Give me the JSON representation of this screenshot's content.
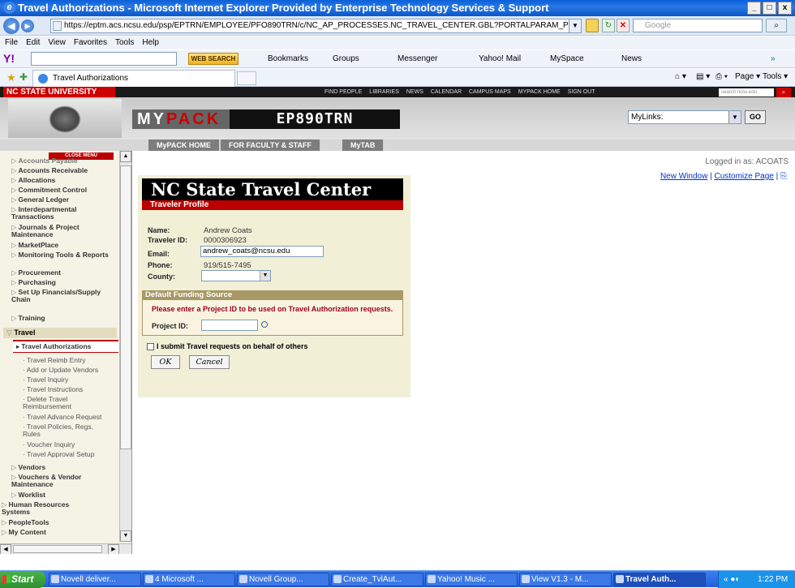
{
  "browser": {
    "title": "Travel Authorizations - Microsoft Internet Explorer Provided by Enterprise Technology Services & Support",
    "url": "https://eptm.acs.ncsu.edu/psp/EPTRN/EMPLOYEE/PFO890TRN/c/NC_AP_PROCESSES.NC_TRAVEL_CENTER.GBL?PORTALPARAM_PTCNAV=NC_1",
    "search_placeholder": "Google",
    "menu": [
      "File",
      "Edit",
      "View",
      "Favorites",
      "Tools",
      "Help"
    ],
    "yahoo_toolbar": {
      "web_search": "WEB SEARCH",
      "items": [
        "Bookmarks",
        "Groups",
        "Messenger",
        "Yahoo! Mail",
        "MySpace",
        "News"
      ]
    },
    "tab_title": "Travel Authorizations",
    "page_menu": "Page",
    "tools_menu": "Tools"
  },
  "ncsu": {
    "brand": "NC STATE UNIVERSITY",
    "links": [
      "FIND PEOPLE",
      "LIBRARIES",
      "NEWS",
      "CALENDAR",
      "CAMPUS MAPS",
      "MYPACK HOME",
      "SIGN OUT"
    ],
    "search_placeholder": "search ncsu.edu",
    "logo_my": "MY",
    "logo_pack": "PACK",
    "env_code": "EP890TRN",
    "mylinks": "MyLinks:",
    "go": "GO",
    "nav_tabs": [
      "MyPACK HOME",
      "FOR FACULTY & STAFF",
      "MyTAB"
    ]
  },
  "sidebar": {
    "close_menu": "CLOSE MENU",
    "items": [
      {
        "label": "Accounts Payable",
        "kind": "item"
      },
      {
        "label": "Accounts Receivable",
        "kind": "item"
      },
      {
        "label": "Allocations",
        "kind": "item"
      },
      {
        "label": "Commitment Control",
        "kind": "item"
      },
      {
        "label": "General Ledger",
        "kind": "item"
      },
      {
        "label": "Interdepartmental Transactions",
        "kind": "item"
      },
      {
        "label": "Journals & Project Maintenance",
        "kind": "item"
      },
      {
        "label": "MarketPlace",
        "kind": "item"
      },
      {
        "label": "Monitoring Tools & Reports",
        "kind": "item"
      },
      {
        "label": "Procurement",
        "kind": "item"
      },
      {
        "label": "Purchasing",
        "kind": "item"
      },
      {
        "label": "Set Up Financials/Supply Chain",
        "kind": "item"
      },
      {
        "label": "Training",
        "kind": "item"
      }
    ],
    "travel": "Travel",
    "travel_items": [
      "Travel Authorizations",
      "Travel Reimb Entry",
      "Add or Update Vendors",
      "Travel Inquiry",
      "Travel Instructions",
      "Delete Travel Reimbursement",
      "Travel Advance Request",
      "Travel Policies, Regs, Rules",
      "Voucher Inquiry",
      "Travel Approval Setup"
    ],
    "after_items": [
      "Vendors",
      "Vouchers & Vendor Maintenance",
      "Worklist"
    ],
    "top_items": [
      "Human Resources Systems",
      "PeopleTools",
      "My Content"
    ]
  },
  "main": {
    "logged_in": "Logged in as: ACOATS",
    "new_window": "New Window",
    "customize_page": "Customize Page",
    "center_title": "NC State Travel Center",
    "section_title": "Traveler Profile",
    "labels": {
      "name": "Name:",
      "traveler_id": "Traveler ID:",
      "email": "Email:",
      "phone": "Phone:",
      "county": "County:"
    },
    "values": {
      "name": "Andrew Coats",
      "traveler_id": "0000306923",
      "email": "andrew_coats@ncsu.edu",
      "phone": "919/515-7495",
      "county": ""
    },
    "funding_title": "Default Funding Source",
    "funding_msg": "Please enter a Project ID to be used on Travel Authorization requests.",
    "project_label": "Project ID:",
    "project_value": "",
    "behalf_label": "I submit Travel requests on behalf of others",
    "behalf_checked": false,
    "ok": "OK",
    "cancel": "Cancel"
  },
  "taskbar": {
    "start": "Start",
    "items": [
      "Novell deliver...",
      "4 Microsoft ...",
      "Novell Group...",
      "Create_TvlAut...",
      "Yahoo! Music ...",
      "View V1.3 - M...",
      "Travel Auth..."
    ],
    "clock": "1:22 PM"
  }
}
